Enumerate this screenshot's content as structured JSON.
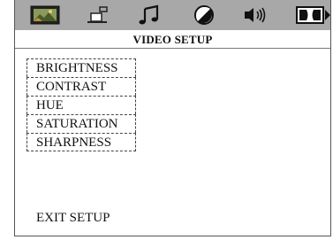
{
  "icons": [
    "tv-picture-icon",
    "speaker-setup-icon",
    "music-note-icon",
    "contrast-circle-icon",
    "audio-speaker-icon",
    "dolby-icon"
  ],
  "header": {
    "title": "VIDEO SETUP"
  },
  "menu": {
    "items": [
      {
        "label": "BRIGHTNESS"
      },
      {
        "label": "CONTRAST"
      },
      {
        "label": "HUE"
      },
      {
        "label": "SATURATION"
      },
      {
        "label": "SHARPNESS"
      }
    ]
  },
  "exit": {
    "label": "EXIT SETUP"
  },
  "colors": {
    "iconbar_bg": "#a8a8a8",
    "background": "#ffffff"
  }
}
